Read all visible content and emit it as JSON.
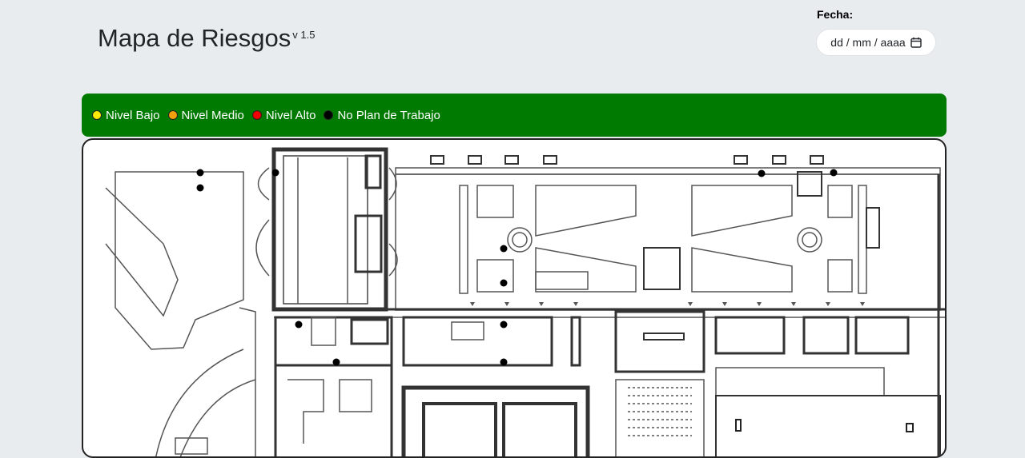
{
  "header": {
    "title": "Mapa de Riesgos",
    "version": "v 1.5"
  },
  "date_filter": {
    "label": "Fecha:",
    "placeholder": "dd / mm / aaaa",
    "icon": "calendar-icon"
  },
  "legend": {
    "background": "#007a00",
    "items": [
      {
        "label": "Nivel Bajo",
        "color": "#ffeb00"
      },
      {
        "label": "Nivel Medio",
        "color": "#f5a000"
      },
      {
        "label": "Nivel Alto",
        "color": "#ee0000"
      },
      {
        "label": "No Plan de Trabajo",
        "color": "#000000"
      }
    ]
  },
  "map": {
    "marker_color": "#000000",
    "marker_level": "No Plan de Trabajo"
  }
}
